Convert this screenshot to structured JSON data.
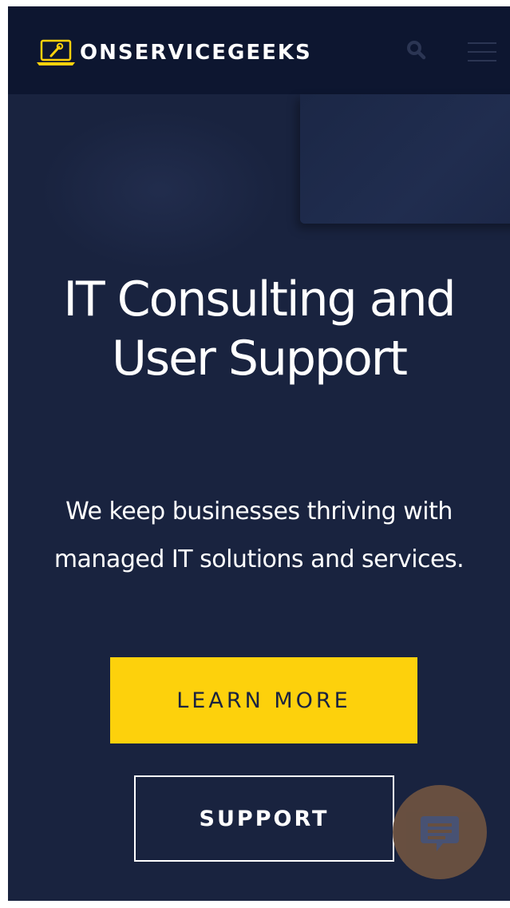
{
  "header": {
    "brand": "ONSERVICEGEEKS",
    "logo_icon": "laptop-wrench-icon",
    "search_icon": "search-icon",
    "menu_icon": "hamburger-menu-icon"
  },
  "hero": {
    "title_line1": "IT Consulting and",
    "title_line2": "User Support",
    "subtitle_line1": "We keep businesses thriving with",
    "subtitle_line2": "managed IT solutions and services."
  },
  "actions": {
    "learn_more_label": "LEARN MORE",
    "support_label": "SUPPORT"
  },
  "chat": {
    "icon": "chat-bubble-icon"
  },
  "colors": {
    "background": "#19233f",
    "header_background": "#0d1630",
    "accent_yellow": "#fdd10c",
    "chat_button": "#6b5141",
    "chat_icon": "#4a5476"
  }
}
